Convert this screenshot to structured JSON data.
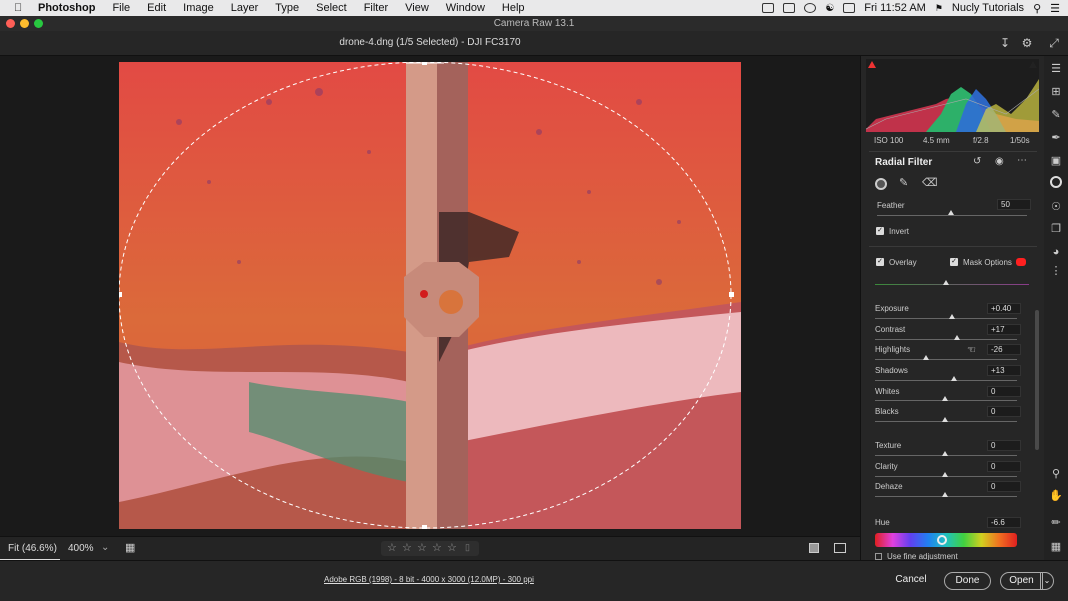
{
  "menubar": {
    "app": "Photoshop",
    "items": [
      "File",
      "Edit",
      "Image",
      "Layer",
      "Type",
      "Select",
      "Filter",
      "View",
      "Window",
      "Help"
    ],
    "clock": "Fri 11:52 AM",
    "user": "Nucly Tutorials"
  },
  "window": {
    "title": "Camera Raw 13.1"
  },
  "toolbar": {
    "document": "drone-4.dng (1/5 Selected)  -  DJI FC3170"
  },
  "canvas": {
    "zoom_fit": "Fit (46.6%)",
    "zoom_value": "400%"
  },
  "exif": {
    "iso": "ISO 100",
    "focal": "4.5 mm",
    "aperture": "f/2.8",
    "shutter": "1/50s"
  },
  "panel": {
    "title": "Radial Filter",
    "feather_label": "Feather",
    "feather_value": "50",
    "invert_label": "Invert",
    "overlay_label": "Overlay",
    "mask_options_label": "Mask Options",
    "mask_color": "#ff2020"
  },
  "adjustments": {
    "exposure": {
      "label": "Exposure",
      "value": "+0.40"
    },
    "contrast": {
      "label": "Contrast",
      "value": "+17"
    },
    "highlights": {
      "label": "Highlights",
      "value": "-26"
    },
    "shadows": {
      "label": "Shadows",
      "value": "+13"
    },
    "whites": {
      "label": "Whites",
      "value": "0"
    },
    "blacks": {
      "label": "Blacks",
      "value": "0"
    },
    "texture": {
      "label": "Texture",
      "value": "0"
    },
    "clarity": {
      "label": "Clarity",
      "value": "0"
    },
    "dehaze": {
      "label": "Dehaze",
      "value": "0"
    },
    "hue": {
      "label": "Hue",
      "value": "-6.6"
    },
    "fine_adjust_label": "Use fine adjustment"
  },
  "footer": {
    "info": "Adobe RGB (1998) - 8 bit - 4000 x 3000 (12.0MP) - 300 ppi",
    "cancel": "Cancel",
    "done": "Done",
    "open": "Open"
  }
}
